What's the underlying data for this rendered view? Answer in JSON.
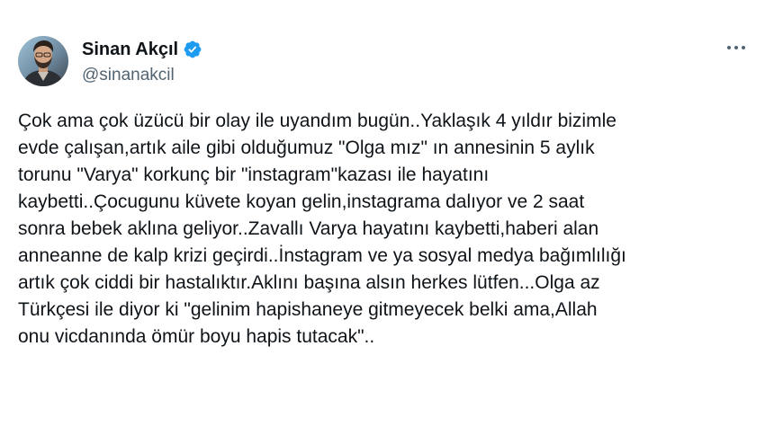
{
  "author": {
    "display_name": "Sinan Akçıl",
    "handle": "@sinanakcil",
    "verified_icon": "verified-badge-icon",
    "verified_color": "#1d9bf0"
  },
  "menu": {
    "more_icon": "more-horizontal-icon"
  },
  "tweet": {
    "lines": [
      "Çok ama çok üzücü bir olay ile uyandım bugün..Yaklaşık 4 yıldır bizimle",
      "evde çalışan,artık aile gibi olduğumuz \"Olga mız\" ın annesinin 5 aylık",
      "torunu \"Varya\" korkunç bir \"instagram\"kazası ile hayatını",
      "kaybetti..Çocugunu küvete koyan gelin,instagrama dalıyor ve 2 saat",
      "sonra bebek aklına geliyor..Zavallı Varya hayatını kaybetti,haberi alan",
      "anneanne de kalp krizi geçirdi..İnstagram ve ya sosyal medya bağımlılığı",
      "artık çok ciddi bir hastalıktır.Aklını başına alsın herkes lütfen...Olga az",
      "Türkçesi ile diyor ki \"gelinim hapishaneye gitmeyecek belki ama,Allah",
      "onu vicdanında ömür boyu hapis tutacak\".."
    ]
  }
}
